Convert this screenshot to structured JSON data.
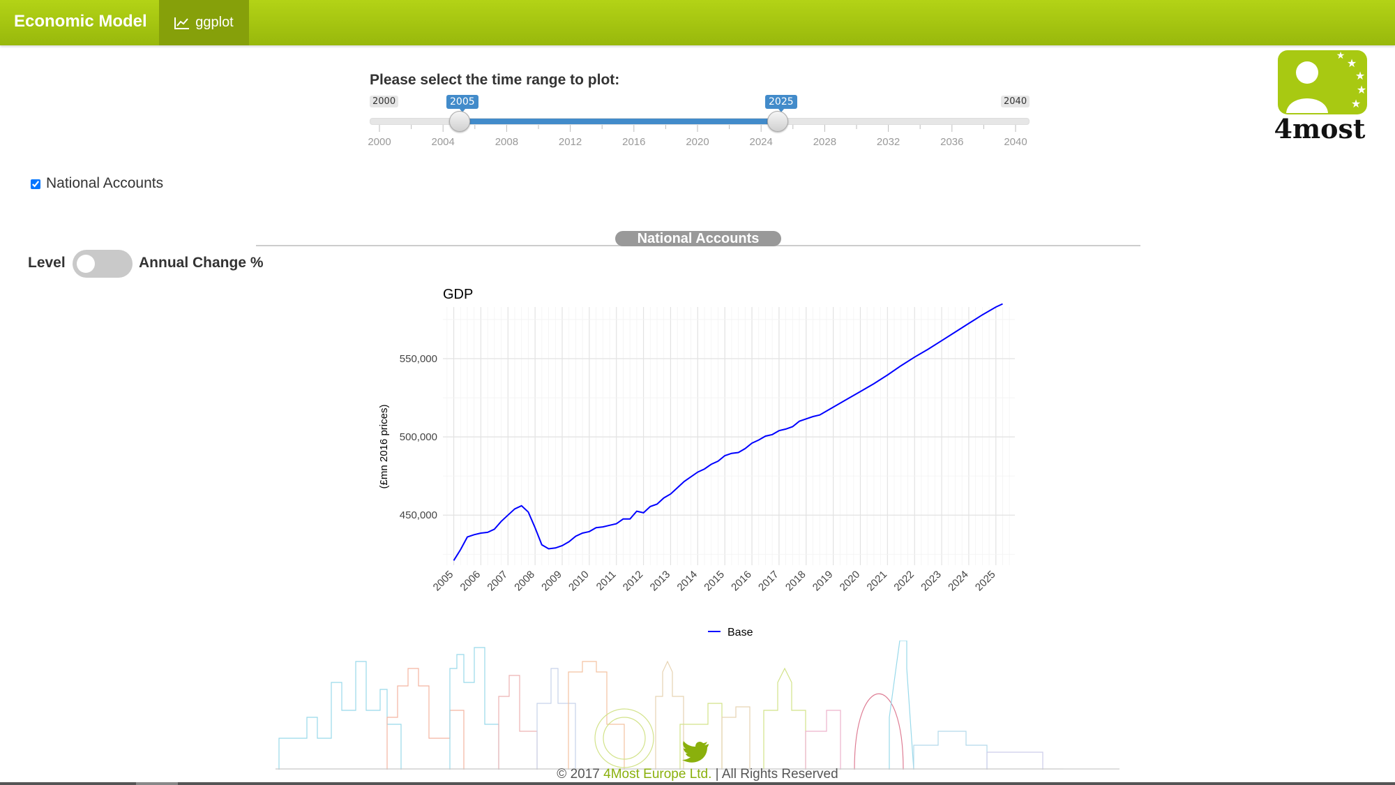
{
  "navbar": {
    "brand": "Economic Model",
    "tab_label": "ggplot",
    "tab_icon": "line-chart-icon",
    "color": "#a8c912"
  },
  "slider": {
    "label": "Please select the time range to plot:",
    "min": 2000,
    "max": 2040,
    "from": 2005,
    "to": 2025,
    "min_label": "2000",
    "max_label": "2040",
    "from_label": "2005",
    "to_label": "2025",
    "grid_labels": [
      "2000",
      "2004",
      "2008",
      "2012",
      "2016",
      "2020",
      "2024",
      "2028",
      "2032",
      "2036",
      "2040"
    ],
    "accent": "#428bca"
  },
  "logo": {
    "text": "4most",
    "icon": "person-stars-logo-icon"
  },
  "checkbox": {
    "label": "National Accounts",
    "checked": true
  },
  "section": {
    "title": "National Accounts"
  },
  "toggle": {
    "left_label": "Level",
    "right_label": "Annual Change %",
    "on": false
  },
  "chart_data": {
    "type": "line",
    "title": "GDP",
    "xlabel": "",
    "ylabel": "(£mn 2016 prices)",
    "categories": [
      "2005",
      "2006",
      "2007",
      "2008",
      "2009",
      "2010",
      "2011",
      "2012",
      "2013",
      "2014",
      "2015",
      "2016",
      "2017",
      "2018",
      "2019",
      "2020",
      "2021",
      "2022",
      "2023",
      "2024",
      "2025"
    ],
    "yticks": [
      "450,000",
      "500,000",
      "550,000"
    ],
    "ylim": [
      418000,
      583000
    ],
    "series": [
      {
        "name": "Base",
        "color": "#0000ff",
        "x": [
          2005.0,
          2005.25,
          2005.5,
          2005.75,
          2006.0,
          2006.25,
          2006.5,
          2006.75,
          2007.0,
          2007.25,
          2007.5,
          2007.75,
          2008.0,
          2008.25,
          2008.5,
          2008.75,
          2009.0,
          2009.25,
          2009.5,
          2009.75,
          2010.0,
          2010.25,
          2010.5,
          2010.75,
          2011.0,
          2011.25,
          2011.5,
          2011.75,
          2012.0,
          2012.25,
          2012.5,
          2012.75,
          2013.0,
          2013.25,
          2013.5,
          2013.75,
          2014.0,
          2014.25,
          2014.5,
          2014.75,
          2015.0,
          2015.25,
          2015.5,
          2015.75,
          2016.0,
          2016.25,
          2016.5,
          2016.75,
          2017.0,
          2017.25,
          2017.5,
          2017.75,
          2018.0,
          2018.25,
          2018.5,
          2018.75,
          2019.0,
          2019.5,
          2020.0,
          2020.5,
          2021.0,
          2021.5,
          2022.0,
          2022.5,
          2023.0,
          2023.5,
          2024.0,
          2024.5,
          2025.0,
          2025.25
        ],
        "values": [
          421000,
          428000,
          436000,
          437500,
          438500,
          439000,
          441000,
          446000,
          450000,
          454000,
          456000,
          452000,
          442000,
          431000,
          428500,
          429000,
          430500,
          433000,
          436500,
          438500,
          439500,
          442000,
          442500,
          443500,
          444500,
          447500,
          447500,
          452500,
          451500,
          455500,
          457000,
          461000,
          463500,
          467500,
          471500,
          474500,
          477500,
          479500,
          482500,
          484500,
          488000,
          489500,
          490000,
          492500,
          496000,
          498000,
          500500,
          501500,
          504000,
          505000,
          506500,
          510000,
          511500,
          513000,
          514000,
          516500,
          519000,
          524000,
          529000,
          534000,
          539500,
          545500,
          551000,
          556000,
          561500,
          567000,
          572500,
          578000,
          583000,
          585000
        ]
      }
    ],
    "legend": "bottom",
    "grid": true
  },
  "footer": {
    "copyright_prefix": "© 2017 ",
    "company": "4Most Europe Ltd.",
    "copyright_suffix": " | All Rights Reserved",
    "twitter_icon": "twitter-icon"
  }
}
